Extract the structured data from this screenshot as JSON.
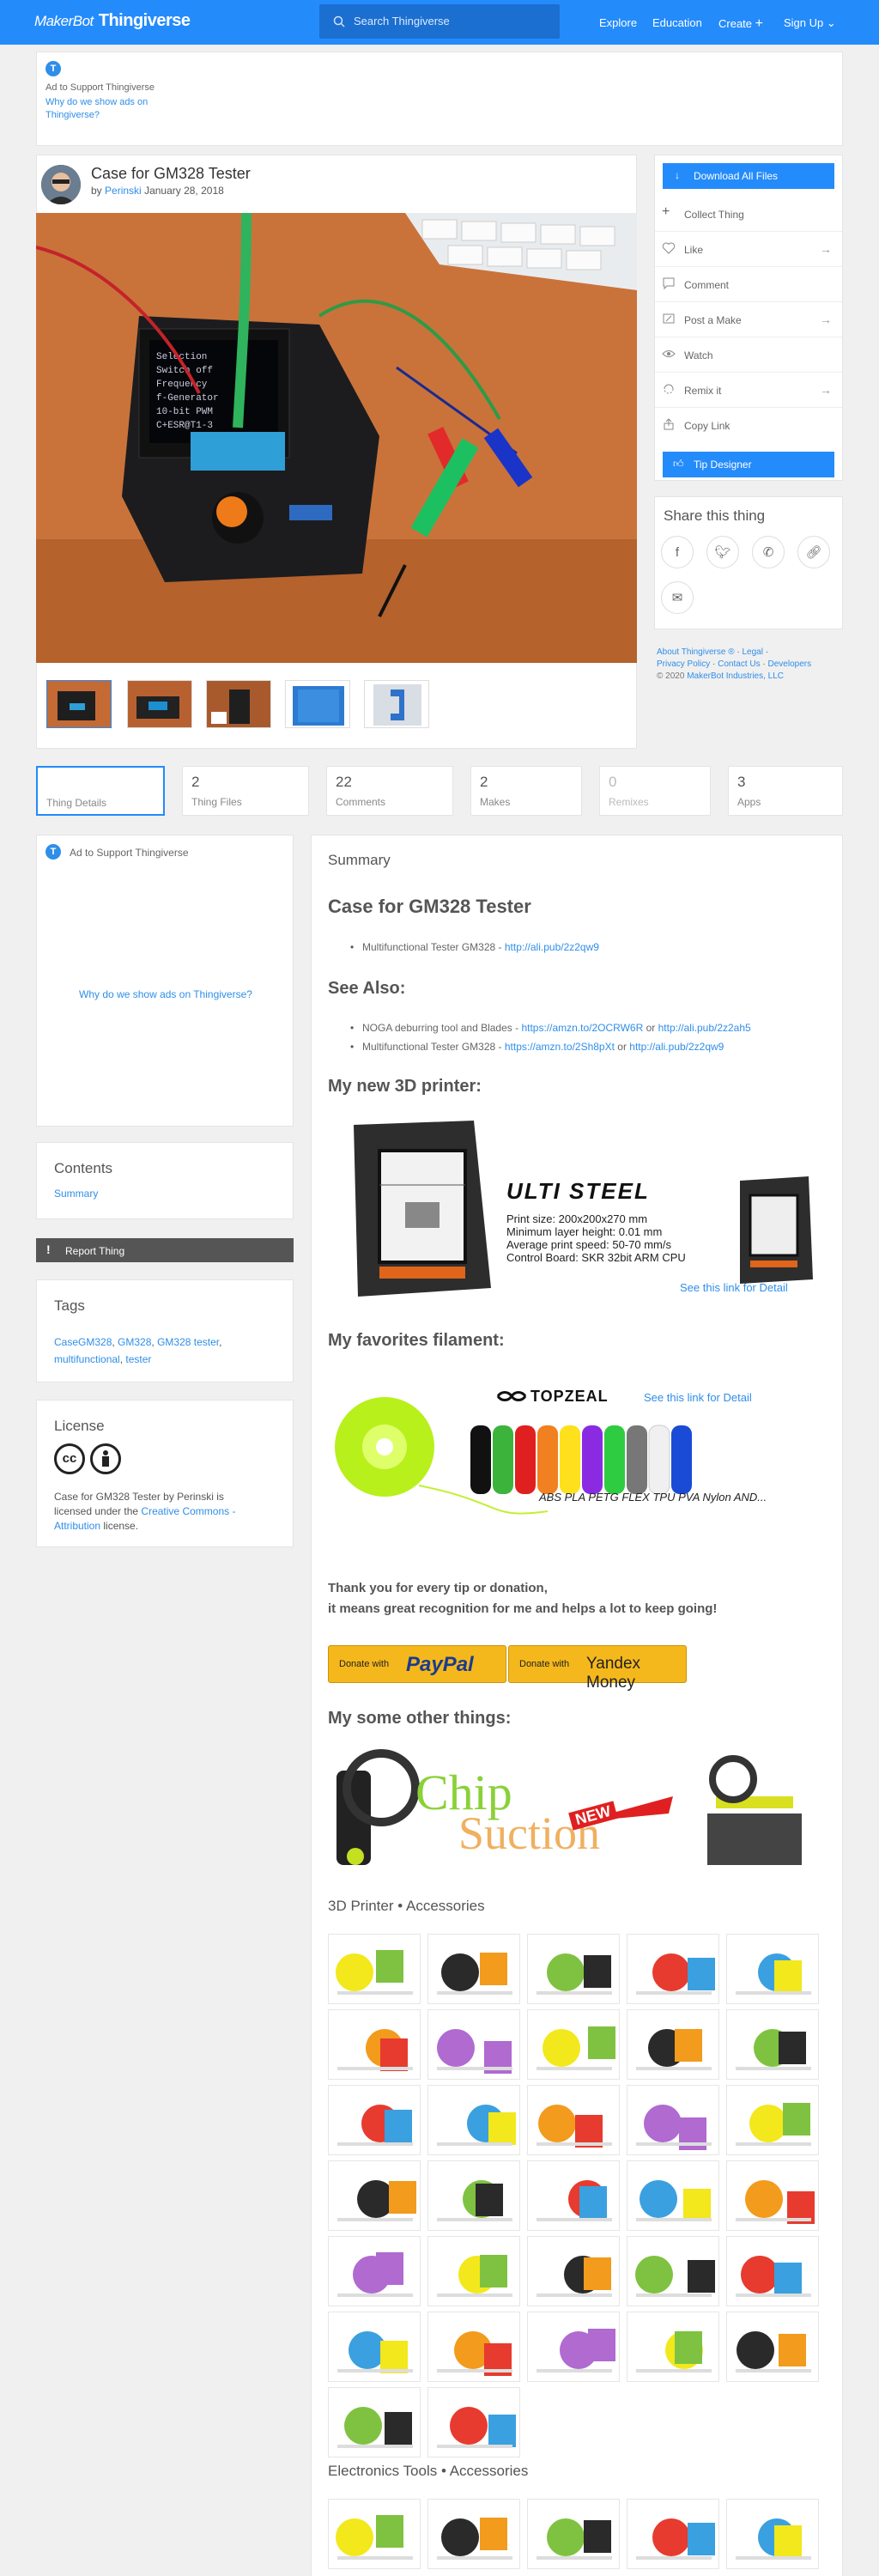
{
  "header": {
    "logo_maker": "MakerBot",
    "logo_brand": "Thingiverse",
    "search_placeholder": "Search Thingiverse",
    "nav": [
      "Explore",
      "Education",
      "Create",
      "Sign Up"
    ]
  },
  "ad_top": {
    "badge": "T",
    "label": "Ad to Support Thingiverse",
    "why": "Why do we show ads on Thingiverse?"
  },
  "thing": {
    "title": "Case for GM328 Tester",
    "by": "by",
    "author": "Perinski",
    "date": "January 28, 2018"
  },
  "actions": {
    "download": "Download All Files",
    "items": [
      "Collect Thing",
      "Like",
      "Comment",
      "Post a Make",
      "Watch",
      "Remix it",
      "Copy Link"
    ],
    "tip": "Tip Designer"
  },
  "share": {
    "title": "Share this thing",
    "icons": [
      "facebook-icon",
      "twitter-icon",
      "whatsapp-icon",
      "link-icon",
      "mail-icon"
    ]
  },
  "footer_links": {
    "line1": [
      "About Thingiverse ®",
      "Legal"
    ],
    "line2": [
      "Privacy Policy",
      "Contact Us",
      "Developers"
    ],
    "copyright": "© 2020",
    "company": "MakerBot Industries, LLC"
  },
  "tabs": [
    {
      "n": "",
      "l": "Thing Details"
    },
    {
      "n": "2",
      "l": "Thing Files"
    },
    {
      "n": "22",
      "l": "Comments"
    },
    {
      "n": "2",
      "l": "Makes"
    },
    {
      "n": "0",
      "l": "Remixes"
    },
    {
      "n": "3",
      "l": "Apps"
    }
  ],
  "left": {
    "ad_label": "Ad to Support Thingiverse",
    "ad_why": "Why do we show ads on Thingiverse?",
    "contents_title": "Contents",
    "contents_link": "Summary",
    "report": "Report Thing",
    "tags_title": "Tags",
    "tags": [
      "CaseGM328",
      "GM328",
      "GM328 tester",
      "multifunctional",
      "tester"
    ],
    "license_title": "License",
    "license_text": "Case for GM328 Tester by Perinski is licensed under the",
    "license_link": "Creative Commons - Attribution",
    "license_end": "license."
  },
  "main": {
    "summary": "Summary",
    "h_case": "Case for GM328 Tester",
    "case_item": "Multifunctional Tester GM328 - ",
    "case_link": "http://ali.pub/2z2qw9",
    "h_see": "See Also:",
    "see1": "NOGA deburring tool and Blades - ",
    "see1_l1": "https://amzn.to/2OCRW6R",
    "see1_or": " or ",
    "see1_l2": "http://ali.pub/2z2ah5",
    "see2": "Multifunctional Tester GM328 - ",
    "see2_l1": "https://amzn.to/2Sh8pXt",
    "see2_or": " or ",
    "see2_l2": "http://ali.pub/2z2qw9",
    "h_printer": "My new 3D printer:",
    "printer_brand": "ULTI STEEL",
    "printer_specs": [
      "Print size: 200x200x270 mm",
      "Minimum layer height: 0.01 mm",
      "Average print speed: 50-70 mm/s",
      "Control Board: SKR 32bit ARM CPU"
    ],
    "printer_link": "See this link for Detail",
    "h_filament": "My favorites filament:",
    "fil_brand": "TOPZEAL",
    "fil_link": "See this link for Detail",
    "fil_types": "ABS PLA PETG FLEX TPU PVA Nylon AND...",
    "thanks1": "Thank you for every tip or donation,",
    "thanks2": "it means great recognition for me and helps a lot to keep going!",
    "paypal_pre": "Donate with",
    "paypal": "PayPal",
    "yandex_pre": "Donate with",
    "yandex": "Yandex Money",
    "h_other": "My some other things:",
    "chip": "Chip",
    "suction": "Suction",
    "new": "NEW",
    "sec_printer": "3D Printer • Accessories",
    "sec_elec": "Electronics Tools • Accessories"
  },
  "colors": {
    "brand": "#248bfb",
    "link": "#2f8ee8",
    "header": "#248bfb"
  }
}
